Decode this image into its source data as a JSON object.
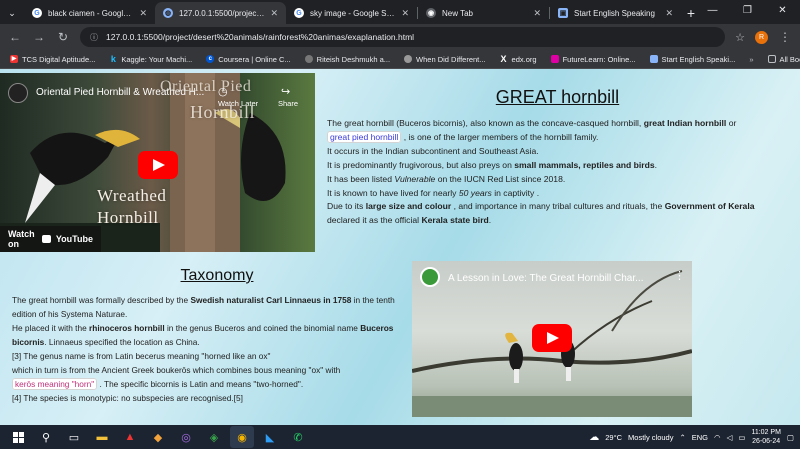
{
  "tabs": [
    {
      "title": "black ciamen - Google Searc",
      "icon": "google-icon",
      "active": false
    },
    {
      "title": "127.0.0.1:5500/project/dese",
      "icon": "globe-icon",
      "active": true
    },
    {
      "title": "sky image - Google Search",
      "icon": "google-icon",
      "active": false
    },
    {
      "title": "New Tab",
      "icon": "chrome-icon",
      "active": false
    },
    {
      "title": "Start English Speaking",
      "icon": "page-icon",
      "active": false
    }
  ],
  "address": {
    "url": "127.0.0.1:5500/project/desert%20animals/rainforest%20animas/exaplanation.html",
    "profile_initial": "R"
  },
  "bookmarks": [
    "TCS Digital Aptitude...",
    "Kaggle: Your Machi...",
    "Coursera | Online C...",
    "Riteish Deshmukh a...",
    "When Did Different...",
    "edx.org",
    "FutureLearn: Online...",
    "Start English Speaki..."
  ],
  "all_bookmarks": "All Bookmarks",
  "video1": {
    "title": "Oriental Pied Hornbill & Wreathed H...",
    "watch_later": "Watch Later",
    "share": "Share",
    "watch_on": "Watch on",
    "youtube": "YouTube",
    "overlay_top_1": "Oriental Pied",
    "overlay_top_2": "Hornbill",
    "overlay_bottom_1": "Wreathed",
    "overlay_bottom_2": "Hornbill"
  },
  "great": {
    "heading": "GREAT hornbill",
    "p1a": "The great hornbill (Buceros bicornis), also known as the concave-casqued hornbill, ",
    "p1b": "great Indian hornbill",
    "p1c": " or ",
    "p1d": "great pied hornbill",
    "p1e": " , is one of the larger members of the hornbill family.",
    "l2": "It occurs in the Indian subcontinent and Southeast Asia.",
    "l3a": "It is predominantly frugivorous, but also preys on ",
    "l3b": "small mammals, reptiles and birds",
    "l3c": ".",
    "l4a": "It has been listed ",
    "l4b": "Vulnerable",
    "l4c": " on the IUCN Red List since 2018.",
    "l5a": "It is known to have lived for nearly ",
    "l5b": "50 years",
    "l5c": " in captivity .",
    "l6a": "Due to its ",
    "l6b": "large size and colour",
    "l6c": " , and importance in many tribal cultures and rituals, the ",
    "l6d": "Government of Kerala",
    "l6e": " declared it as the official ",
    "l6f": "Kerala state bird",
    "l6g": "."
  },
  "taxonomy": {
    "heading": "Taxonomy",
    "t1a": "The great hornbill was formally described by the ",
    "t1b": "Swedish naturalist Carl Linnaeus in 1758",
    "t1c": " in the tenth edition of his Systema Naturae.",
    "t2a": "He placed it with the ",
    "t2b": "rhinoceros hornbill",
    "t2c": " in the genus Buceros and coined the binomial name ",
    "t2d": "Buceros bicornis",
    "t2e": ". Linnaeus specified the location as China.",
    "t3": "[3] The genus name is from Latin becerus meaning \"horned like an ox\"",
    "t4": "which in turn is from the Ancient Greek boukerōs which combines bous meaning \"ox\" with",
    "t5a": "kerōs meaning \"horn\"",
    "t5b": " . The specific bicornis is Latin and means \"two-horned\".",
    "t6": "[4] The species is monotypic: no subspecies are recognised.[5]"
  },
  "video2": {
    "title": "A Lesson in Love: The Great Hornbill Char..."
  },
  "taskbar": {
    "weather": "29°C",
    "weather_text": "Mostly cloudy",
    "lang": "ENG",
    "time": "11:02 PM",
    "date": "26-06-24"
  }
}
